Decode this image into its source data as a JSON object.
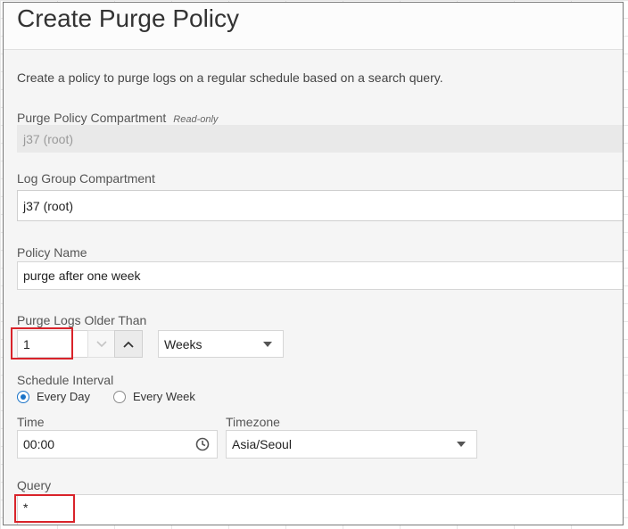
{
  "page": {
    "title": "Create Purge Policy",
    "description": "Create a policy to purge logs on a regular schedule based on a search query."
  },
  "purge_compartment": {
    "label": "Purge Policy Compartment",
    "readonly_tag": "Read-only",
    "value": "j37 (root)"
  },
  "log_group_compartment": {
    "label": "Log Group Compartment",
    "value": "j37 (root)"
  },
  "policy_name": {
    "label": "Policy Name",
    "value": "purge after one week"
  },
  "purge_older": {
    "label": "Purge Logs Older Than",
    "value": "1",
    "unit": "Weeks"
  },
  "schedule": {
    "label": "Schedule Interval",
    "options": [
      "Every Day",
      "Every Week"
    ],
    "selected": "Every Day"
  },
  "time": {
    "label": "Time",
    "value": "00:00"
  },
  "timezone": {
    "label": "Timezone",
    "value": "Asia/Seoul"
  },
  "query": {
    "label": "Query",
    "value": "*"
  },
  "colors": {
    "accent": "#1a73c8",
    "highlight": "#d9232a",
    "panel_bg": "#f5f5f5"
  }
}
